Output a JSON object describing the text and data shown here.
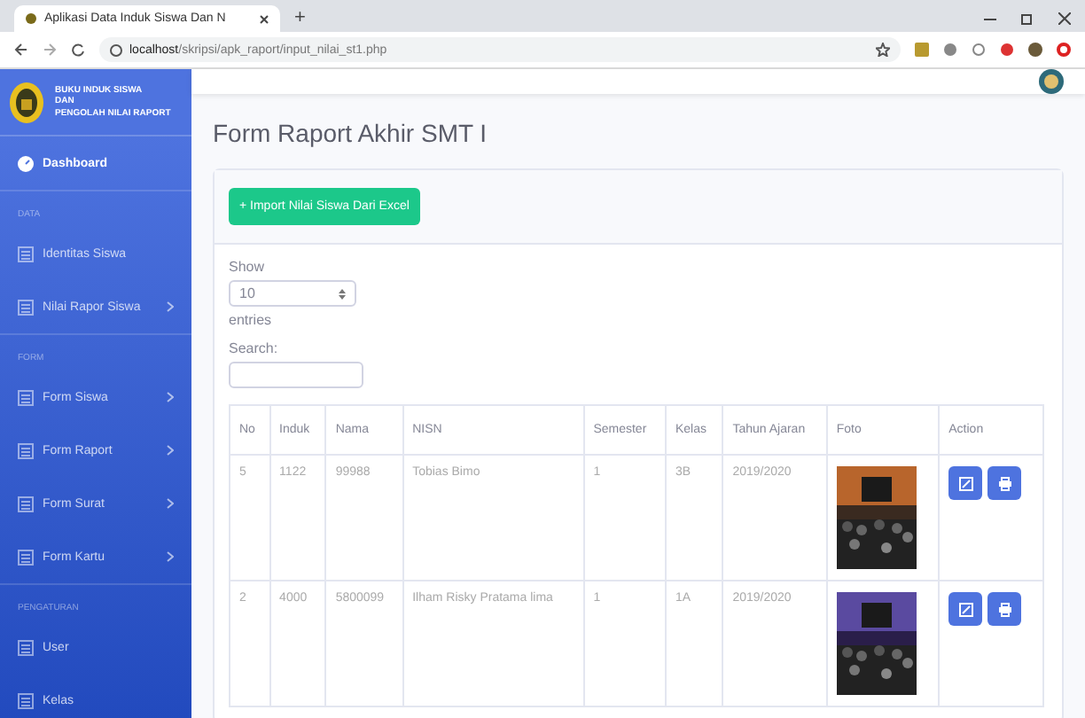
{
  "browser": {
    "tab_title": "Aplikasi Data Induk Siswa Dan N",
    "new_tab": "+",
    "url_host": "localhost",
    "url_path": "/skripsi/apk_raport/input_nilai_st1.php"
  },
  "sidebar": {
    "brand": [
      "BUKU INDUK SISWA",
      "DAN",
      "PENGOLAH NILAI RAPORT"
    ],
    "items": [
      {
        "kind": "link",
        "label": "Dashboard",
        "selected": true,
        "has_chevron": false
      },
      {
        "kind": "heading",
        "label": "DATA"
      },
      {
        "kind": "link",
        "label": "Identitas Siswa",
        "selected": false,
        "has_chevron": false
      },
      {
        "kind": "link",
        "label": "Nilai Rapor Siswa",
        "selected": false,
        "has_chevron": true
      },
      {
        "kind": "heading",
        "label": "FORM"
      },
      {
        "kind": "link",
        "label": "Form Siswa",
        "selected": false,
        "has_chevron": true
      },
      {
        "kind": "link",
        "label": "Form Raport",
        "selected": false,
        "has_chevron": true
      },
      {
        "kind": "link",
        "label": "Form Surat",
        "selected": false,
        "has_chevron": true
      },
      {
        "kind": "link",
        "label": "Form Kartu",
        "selected": false,
        "has_chevron": true
      },
      {
        "kind": "heading",
        "label": "PENGATURAN"
      },
      {
        "kind": "link",
        "label": "User",
        "selected": false,
        "has_chevron": false
      },
      {
        "kind": "link",
        "label": "Kelas",
        "selected": false,
        "has_chevron": false
      }
    ]
  },
  "page_title": "Form Raport Akhir SMT I",
  "import_button": "+ Import Nilai Siswa Dari Excel",
  "length": {
    "show": "Show",
    "value": "10",
    "entries": "entries"
  },
  "search": {
    "label": "Search:"
  },
  "table": {
    "columns": [
      "No",
      "Induk",
      "Nama",
      "NISN",
      "Semester",
      "Kelas",
      "Tahun Ajaran",
      "Foto",
      "Action"
    ],
    "rows": [
      {
        "cells": [
          "5",
          "1122",
          "99988",
          "Tobias Bimo",
          "1",
          "3B",
          "2019/2020"
        ]
      },
      {
        "cells": [
          "2",
          "4000",
          "5800099",
          "Ilham Risky Pratama lima",
          "1",
          "1A",
          "2019/2020"
        ]
      }
    ]
  }
}
